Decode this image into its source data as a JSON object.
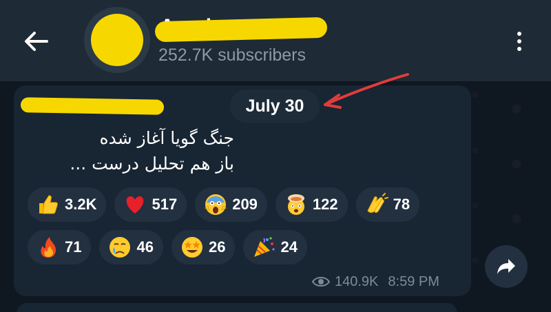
{
  "header": {
    "channel_name": "Arash ...",
    "subscribers": "252.7K subscribers",
    "back_icon": "arrow-left-icon",
    "menu_icon": "more-vertical-icon"
  },
  "message": {
    "date": "July 30",
    "lines": [
      "جنگ گویا آغاز شده",
      "باز هم تحلیل درست ..."
    ],
    "views": "140.9K",
    "time": "8:59 PM"
  },
  "reactions": [
    {
      "icon": "thumbs-up-icon",
      "count": "3.2K"
    },
    {
      "icon": "red-heart-icon",
      "count": "517"
    },
    {
      "icon": "screaming-face-icon",
      "count": "209"
    },
    {
      "icon": "exploding-head-icon",
      "count": "122"
    },
    {
      "icon": "clapping-hands-icon",
      "count": "78"
    },
    {
      "icon": "fire-icon",
      "count": "71"
    },
    {
      "icon": "crying-face-icon",
      "count": "46"
    },
    {
      "icon": "star-struck-icon",
      "count": "26"
    },
    {
      "icon": "party-popper-icon",
      "count": "24"
    }
  ],
  "colors": {
    "header_bg": "#1e2a35",
    "bubble_bg": "#182533",
    "chip_bg": "#223040",
    "redaction": "#f6d800",
    "annotation": "#e03c3c"
  }
}
